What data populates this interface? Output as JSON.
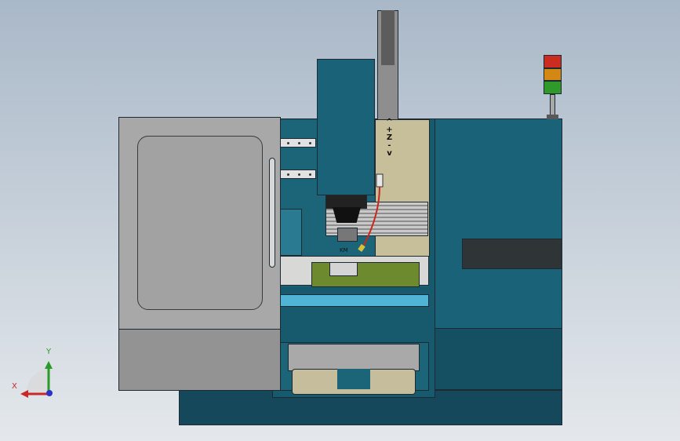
{
  "labels": {
    "z_axis": "^+Z-v",
    "chuck_mark": "KM"
  },
  "triad": {
    "x": "X",
    "y": "Y"
  },
  "colors": {
    "body_teal": "#1a6278",
    "table_blue": "#4fb4d6",
    "door_gray": "#a8a8a8",
    "vise_green": "#6e8a2e",
    "light_red": "#cc2c1f",
    "light_amber": "#d28812",
    "light_green": "#2f9a2a"
  }
}
